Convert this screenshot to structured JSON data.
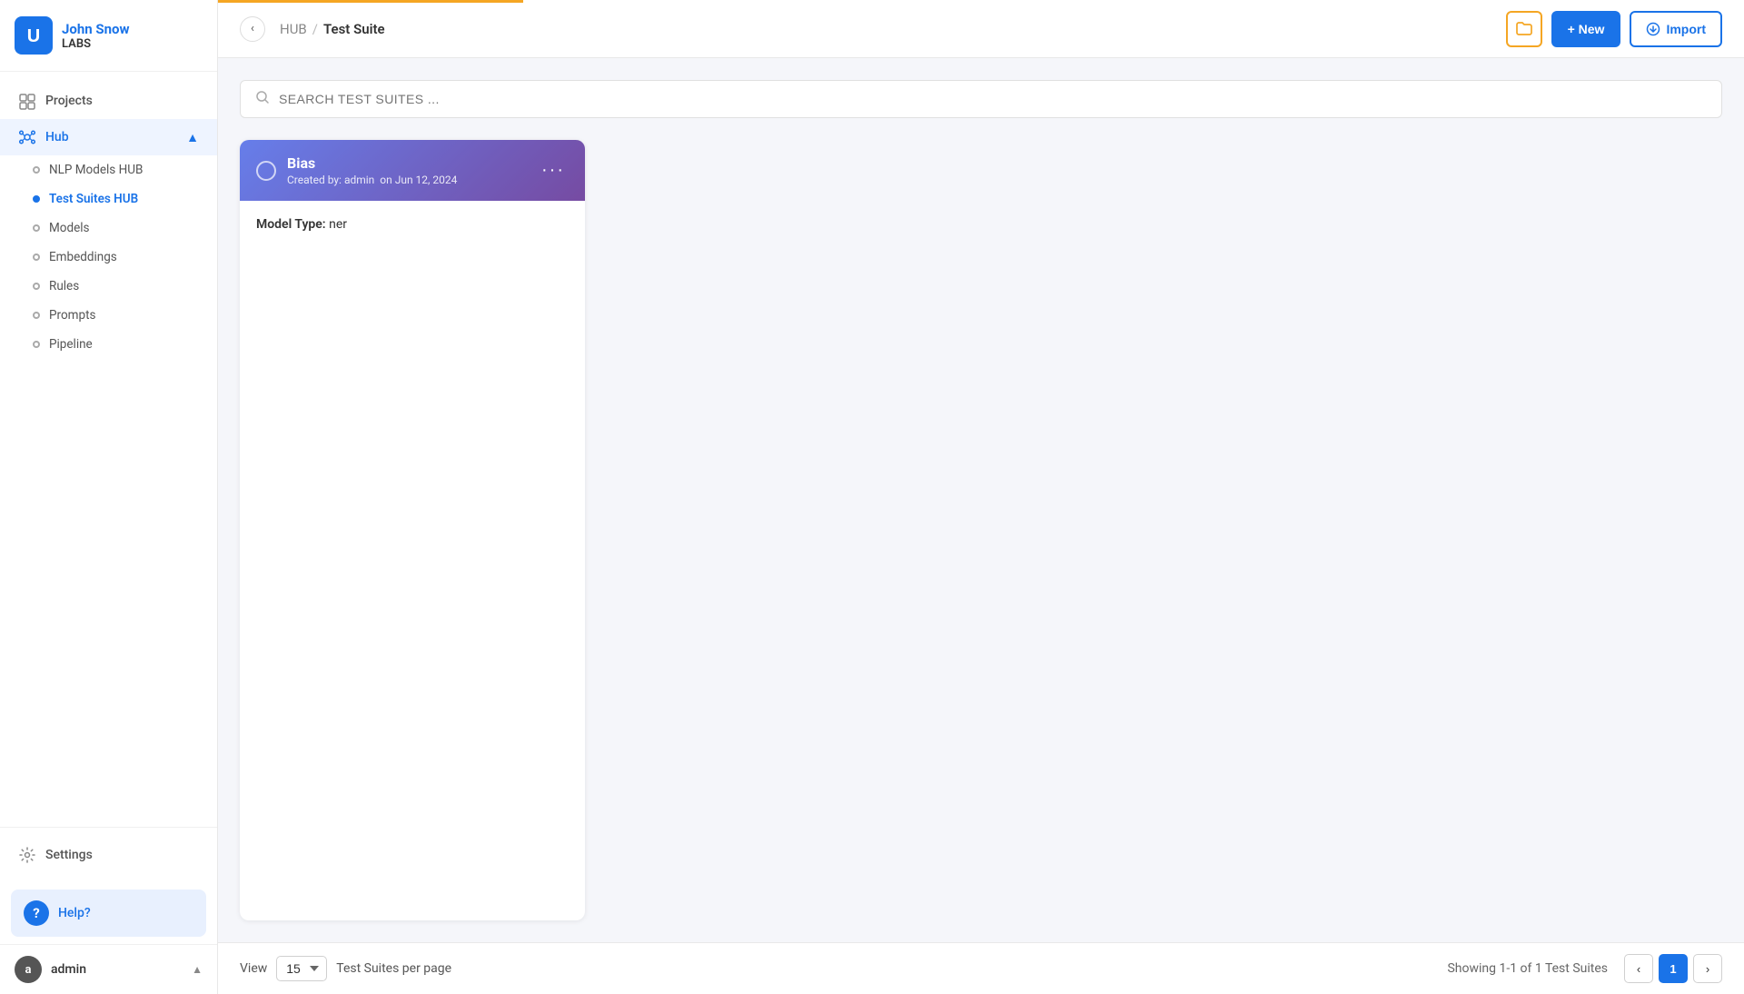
{
  "sidebar": {
    "logo_line1": "John Snow",
    "logo_line2": "LABS",
    "nav_items": [
      {
        "id": "projects",
        "label": "Projects",
        "icon": "projects-icon"
      },
      {
        "id": "hub",
        "label": "Hub",
        "icon": "hub-icon",
        "active": true,
        "expanded": true
      }
    ],
    "hub_sub_items": [
      {
        "id": "nlp-models-hub",
        "label": "NLP Models HUB",
        "active": false
      },
      {
        "id": "test-suites-hub",
        "label": "Test Suites HUB",
        "active": true
      },
      {
        "id": "models",
        "label": "Models",
        "active": false
      },
      {
        "id": "embeddings",
        "label": "Embeddings",
        "active": false
      },
      {
        "id": "rules",
        "label": "Rules",
        "active": false
      },
      {
        "id": "prompts",
        "label": "Prompts",
        "active": false
      },
      {
        "id": "pipeline",
        "label": "Pipeline",
        "active": false
      }
    ],
    "settings_label": "Settings",
    "help_label": "Help?",
    "user_name": "admin",
    "user_initial": "a"
  },
  "topbar": {
    "breadcrumb_hub": "HUB",
    "breadcrumb_sep": "/",
    "breadcrumb_current": "Test Suite",
    "btn_new_label": "+ New",
    "btn_import_label": "Import"
  },
  "search": {
    "placeholder": "SEARCH TEST SUITES ..."
  },
  "cards": [
    {
      "id": "bias",
      "title": "Bias",
      "created_by": "admin",
      "created_on": "Jun 12, 2024",
      "model_type_label": "Model Type:",
      "model_type_value": "ner"
    }
  ],
  "footer": {
    "view_label": "View",
    "per_page": "15",
    "per_page_suffix": "Test Suites per page",
    "pagination_info": "Showing 1-1 of 1 Test Suites",
    "current_page": "1"
  }
}
